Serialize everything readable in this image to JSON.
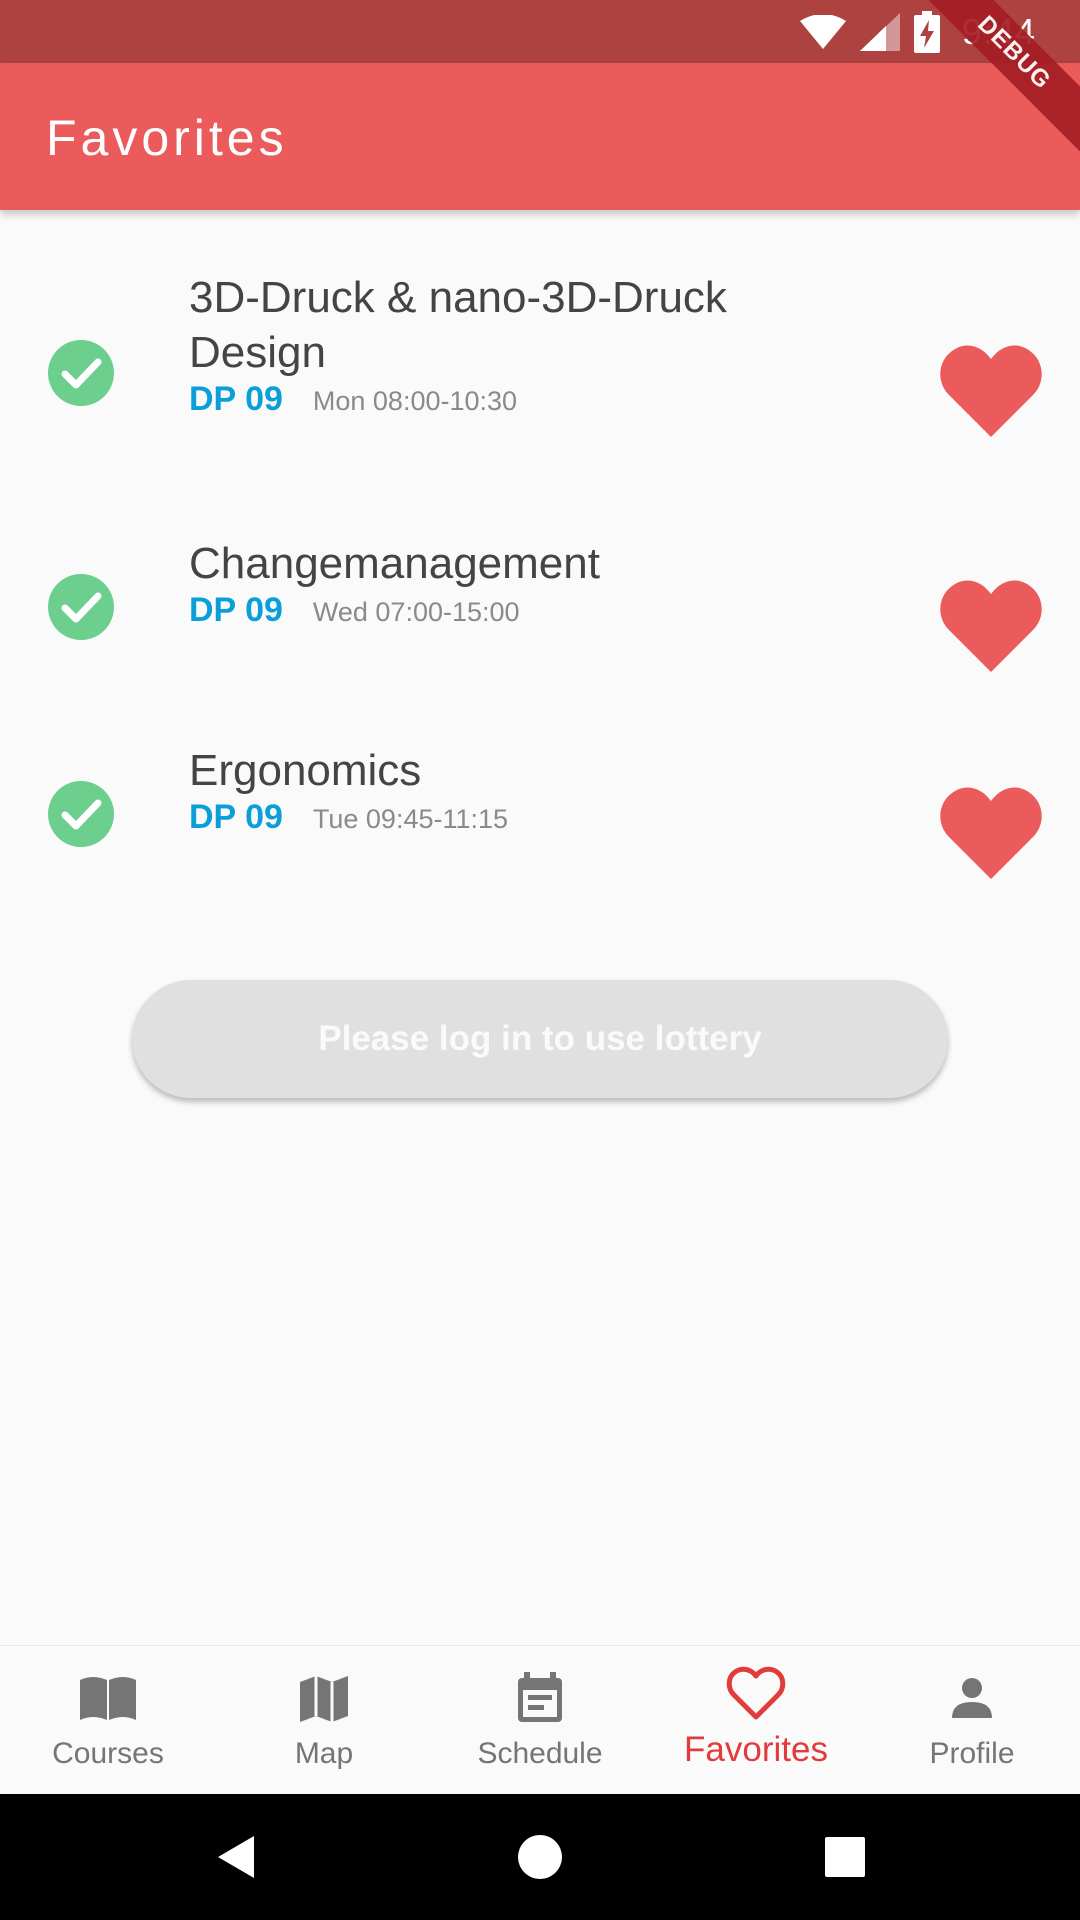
{
  "status_bar": {
    "time": "9:44"
  },
  "debug_label": "DEBUG",
  "app_bar": {
    "title": "Favorites"
  },
  "courses": [
    {
      "title": "3D-Druck & nano-3D-Druck Design",
      "room": "DP 09",
      "time": "Mon 08:00-10:30",
      "favorite": true,
      "enrolled": true
    },
    {
      "title": "Changemanagement",
      "room": "DP 09",
      "time": "Wed 07:00-15:00",
      "favorite": true,
      "enrolled": true
    },
    {
      "title": "Ergonomics",
      "room": "DP 09",
      "time": "Tue 09:45-11:15",
      "favorite": true,
      "enrolled": true
    }
  ],
  "lottery_button": {
    "label": "Please log in to use lottery"
  },
  "bottom_nav": {
    "items": [
      {
        "label": "Courses",
        "icon": "book-icon"
      },
      {
        "label": "Map",
        "icon": "map-icon"
      },
      {
        "label": "Schedule",
        "icon": "calendar-icon"
      },
      {
        "label": "Favorites",
        "icon": "heart-outline-icon"
      },
      {
        "label": "Profile",
        "icon": "person-icon"
      }
    ],
    "active": "Favorites"
  },
  "colors": {
    "status_bar": "#ad4240",
    "app_bar": "#eb5b5b",
    "accent_heart": "#eb5b5b",
    "check": "#6ccf8e",
    "room": "#0a9fd8",
    "nav_active": "#e23b3b"
  }
}
